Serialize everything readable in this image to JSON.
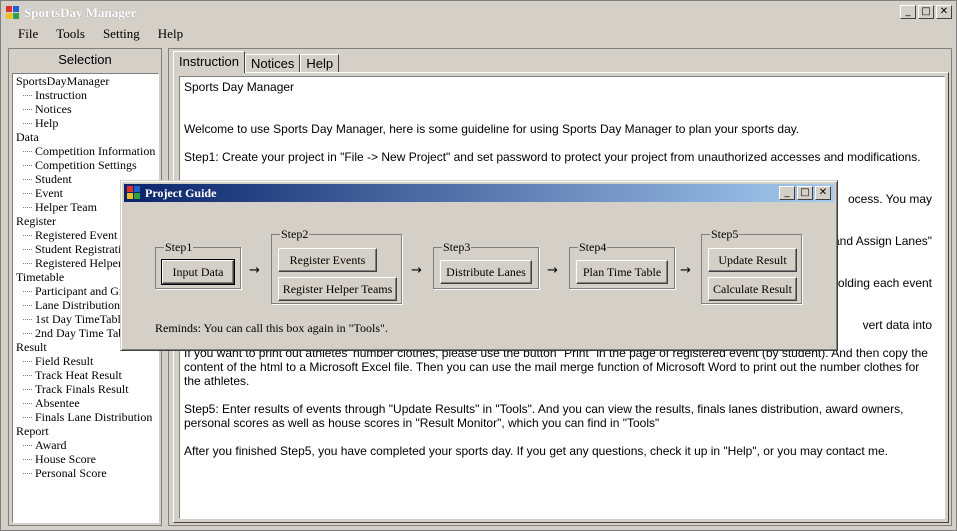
{
  "window": {
    "title": "SportsDay Manager",
    "min": "_",
    "max": "□",
    "close": "✕"
  },
  "menu": [
    "File",
    "Tools",
    "Setting",
    "Help"
  ],
  "selection": {
    "header": "Selection",
    "tree": [
      {
        "label": "SportsDayManager",
        "level": 0
      },
      {
        "label": "Instruction",
        "level": 1
      },
      {
        "label": "Notices",
        "level": 1
      },
      {
        "label": "Help",
        "level": 1
      },
      {
        "label": "Data",
        "level": 0
      },
      {
        "label": "Competition Information",
        "level": 1
      },
      {
        "label": "Competition Settings",
        "level": 1
      },
      {
        "label": "Student",
        "level": 1
      },
      {
        "label": "Event",
        "level": 1
      },
      {
        "label": "Helper Team",
        "level": 1
      },
      {
        "label": "Register",
        "level": 0
      },
      {
        "label": "Registered Event",
        "level": 1
      },
      {
        "label": "Student Registration",
        "level": 1
      },
      {
        "label": "Registered Helper",
        "level": 1
      },
      {
        "label": "Timetable",
        "level": 0
      },
      {
        "label": "Participant and Group",
        "level": 1
      },
      {
        "label": "Lane Distribution",
        "level": 1
      },
      {
        "label": "1st Day TimeTable",
        "level": 1
      },
      {
        "label": "2nd Day Time Table",
        "level": 1
      },
      {
        "label": "Result",
        "level": 0
      },
      {
        "label": "Field Result",
        "level": 1
      },
      {
        "label": "Track Heat Result",
        "level": 1
      },
      {
        "label": "Track Finals Result",
        "level": 1
      },
      {
        "label": "Absentee",
        "level": 1
      },
      {
        "label": "Finals Lane Distribution",
        "level": 1
      },
      {
        "label": "Report",
        "level": 0
      },
      {
        "label": "Award",
        "level": 1
      },
      {
        "label": "House Score",
        "level": 1
      },
      {
        "label": "Personal Score",
        "level": 1
      }
    ]
  },
  "tabs": [
    "Instruction",
    "Notices",
    "Help"
  ],
  "instruction": [
    "Sports Day Manager",
    "",
    "Welcome to use Sports Day Manager, here is some guideline for using Sports Day Manager to plan your sports day.",
    "Step1: Create your project in \"File -> New Project\" and set password to protect your project from unauthorized accesses and modifications.",
    "Step2: ... [hidden] ... ocess. You may",
    "... and Assign Lanes\"",
    "... olding each event",
    "... vert data into",
    "If you want to print out athletes' number clothes, please use the button \"Print\" in the page of registered event (by student). And then copy the content of the html to a Microsoft Excel file. Then you can use the mail merge function of Microsoft Word to print out the number clothes for the athletes.",
    "Step5: Enter results of events through \"Update Results\" in \"Tools\". And you can view the results, finals lanes distribution, award owners, personal scores as well as house scores in \"Result Monitor\", which you can find in \"Tools\"",
    "After you finished Step5, you have completed your sports day. If you get any questions, check it up in \"Help\", or you may contact me."
  ],
  "partial": {
    "l1": "ocess. You may",
    "l2": "and Assign Lanes\"",
    "l3": "olding each event",
    "l4": "vert data into"
  },
  "dialog": {
    "title": "Project Guide",
    "step1": {
      "label": "Step1",
      "btn": "Input Data"
    },
    "step2": {
      "label": "Step2",
      "btn1": "Register Events",
      "btn2": "Register Helper Teams"
    },
    "step3": {
      "label": "Step3",
      "btn": "Distribute Lanes"
    },
    "step4": {
      "label": "Step4",
      "btn": "Plan Time Table"
    },
    "step5": {
      "label": "Step5",
      "btn1": "Update Result",
      "btn2": "Calculate Result"
    },
    "arrow": "→",
    "remind": "Reminds: You can call this box again in \"Tools\"."
  }
}
